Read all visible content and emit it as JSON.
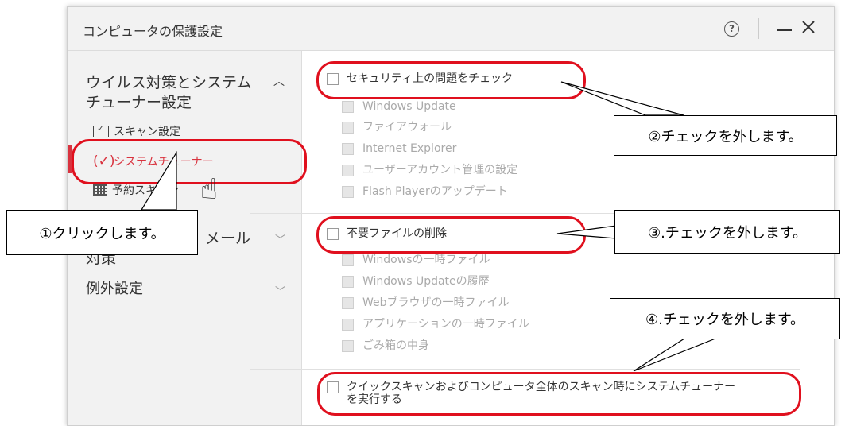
{
  "window": {
    "title": "コンピュータの保護設定",
    "help_glyph": "?"
  },
  "sidebar": {
    "section1": {
      "line1": "ウイルス対策とシステム",
      "line2": "チューナー設定"
    },
    "items": [
      {
        "label": "スキャン設定",
        "icon": "scan-icon"
      },
      {
        "label": "システムチューナー",
        "icon": "gauge-icon",
        "active": true
      },
      {
        "label": "予約スキャン",
        "icon": "calendar-icon"
      }
    ],
    "section2": {
      "line1": "メール",
      "line2": "対策"
    },
    "section3": {
      "label": "例外設定"
    }
  },
  "content": {
    "groups": [
      {
        "label": "セキュリティ上の問題をチェック",
        "checked": false,
        "children": [
          "Windows Update",
          "ファイアウォール",
          "Internet Explorer",
          "ユーザーアカウント管理の設定",
          "Flash Playerのアップデート"
        ]
      },
      {
        "label": "不要ファイルの削除",
        "checked": false,
        "children": [
          "Windowsの一時ファイル",
          "Windows Updateの履歴",
          "Webブラウザの一時ファイル",
          "アプリケーションの一時ファイル",
          "ごみ箱の中身"
        ]
      }
    ],
    "quick_scan": {
      "line1": "クイックスキャンおよびコンピュータ全体のスキャン時にシステムチューナー",
      "line2": "を実行する",
      "checked": false
    }
  },
  "annotations": {
    "click": "①クリックします。",
    "uncheck2": "②チェックを外します。",
    "uncheck3": "③.チェックを外します。",
    "uncheck4": "④.チェックを外します。"
  },
  "colors": {
    "accent_red": "#d9333f",
    "annotation_red": "#e0101e"
  }
}
